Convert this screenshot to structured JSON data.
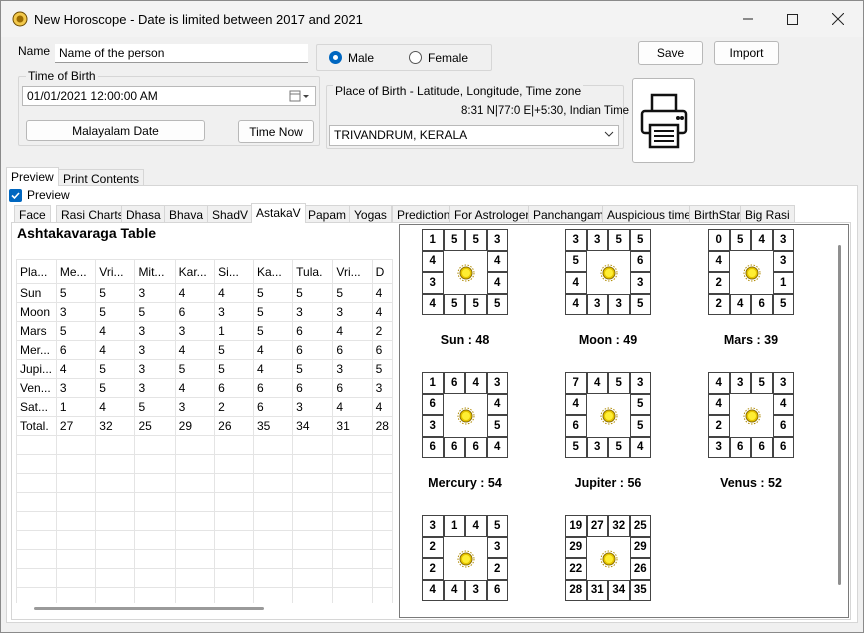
{
  "window": {
    "title": "New Horoscope - Date is limited between 2017 and 2021"
  },
  "form": {
    "name_label": "Name",
    "name_value": "Name of the person",
    "gender_male": "Male",
    "gender_female": "Female",
    "gender_selected": "Male",
    "save_label": "Save",
    "import_label": "Import",
    "time_of_birth_label": "Time of Birth",
    "datetime_value": "01/01/2021  12:00:00 AM",
    "malayalam_date_label": "Malayalam Date",
    "time_now_label": "Time Now",
    "place_label": "Place of Birth - Latitude, Longitude, Time zone",
    "coords_text": "8:31 N|77:0 E|+5:30, Indian Time",
    "place_value": "TRIVANDRUM, KERALA",
    "print_icon": "printer-icon"
  },
  "outer_tabs": [
    "Preview",
    "Print Contents"
  ],
  "preview_checkbox": {
    "label": "Preview",
    "checked": true
  },
  "inner_tabs": [
    "Face",
    "Rasi Charts",
    "Dhasa",
    "Bhava",
    "ShadV",
    "AstakaV",
    "Papam",
    "Yogas",
    "Prediction",
    "For Astrologer",
    "Panchangam",
    "Auspicious time",
    "BirthStar",
    "Big Rasi"
  ],
  "selected_inner_tab": "AstakaV",
  "table": {
    "title": "Ashtakavaraga Table",
    "headers": [
      "Pla...",
      "Me...",
      "Vri...",
      "Mit...",
      "Kar...",
      "Si...",
      "Ka...",
      "Tula.",
      "Vri...",
      "D"
    ],
    "rows": [
      [
        "Sun",
        "5",
        "5",
        "3",
        "4",
        "4",
        "5",
        "5",
        "5",
        "4"
      ],
      [
        "Moon",
        "3",
        "5",
        "5",
        "6",
        "3",
        "5",
        "3",
        "3",
        "4"
      ],
      [
        "Mars",
        "5",
        "4",
        "3",
        "3",
        "1",
        "5",
        "6",
        "4",
        "2"
      ],
      [
        "Mer...",
        "6",
        "4",
        "3",
        "4",
        "5",
        "4",
        "6",
        "6",
        "6"
      ],
      [
        "Jupi...",
        "4",
        "5",
        "3",
        "5",
        "5",
        "4",
        "5",
        "3",
        "5"
      ],
      [
        "Ven...",
        "3",
        "5",
        "3",
        "4",
        "6",
        "6",
        "6",
        "6",
        "3"
      ],
      [
        "Sat...",
        "1",
        "4",
        "5",
        "3",
        "2",
        "6",
        "3",
        "4",
        "4"
      ],
      [
        "Total.",
        "27",
        "32",
        "25",
        "29",
        "26",
        "35",
        "34",
        "31",
        "28"
      ]
    ]
  },
  "charts": [
    {
      "label": "Sun : 48",
      "top": [
        "1",
        "5",
        "5",
        "3"
      ],
      "left": [
        "4",
        "3"
      ],
      "right": [
        "4",
        "4"
      ],
      "bottom": [
        "4",
        "5",
        "5",
        "5"
      ]
    },
    {
      "label": "Moon : 49",
      "top": [
        "3",
        "3",
        "5",
        "5"
      ],
      "left": [
        "5",
        "4"
      ],
      "right": [
        "6",
        "3"
      ],
      "bottom": [
        "4",
        "3",
        "3",
        "5"
      ]
    },
    {
      "label": "Mars : 39",
      "top": [
        "0",
        "5",
        "4",
        "3"
      ],
      "left": [
        "4",
        "2"
      ],
      "right": [
        "3",
        "1"
      ],
      "bottom": [
        "2",
        "4",
        "6",
        "5"
      ]
    },
    {
      "label": "Mercury : 54",
      "top": [
        "1",
        "6",
        "4",
        "3"
      ],
      "left": [
        "6",
        "3"
      ],
      "right": [
        "4",
        "5"
      ],
      "bottom": [
        "6",
        "6",
        "6",
        "4"
      ]
    },
    {
      "label": "Jupiter : 56",
      "top": [
        "7",
        "4",
        "5",
        "3"
      ],
      "left": [
        "4",
        "6"
      ],
      "right": [
        "5",
        "5"
      ],
      "bottom": [
        "5",
        "3",
        "5",
        "4"
      ]
    },
    {
      "label": "Venus : 52",
      "top": [
        "4",
        "3",
        "5",
        "3"
      ],
      "left": [
        "4",
        "2"
      ],
      "right": [
        "4",
        "6"
      ],
      "bottom": [
        "3",
        "6",
        "6",
        "6"
      ]
    },
    {
      "label": "",
      "top": [
        "3",
        "1",
        "4",
        "5"
      ],
      "left": [
        "2",
        "2"
      ],
      "right": [
        "3",
        "2"
      ],
      "bottom": [
        "4",
        "4",
        "3",
        "6"
      ]
    },
    {
      "label": "",
      "top": [
        "19",
        "27",
        "32",
        "25"
      ],
      "left": [
        "29",
        "22"
      ],
      "right": [
        "29",
        "26"
      ],
      "bottom": [
        "28",
        "31",
        "34",
        "35"
      ]
    }
  ]
}
